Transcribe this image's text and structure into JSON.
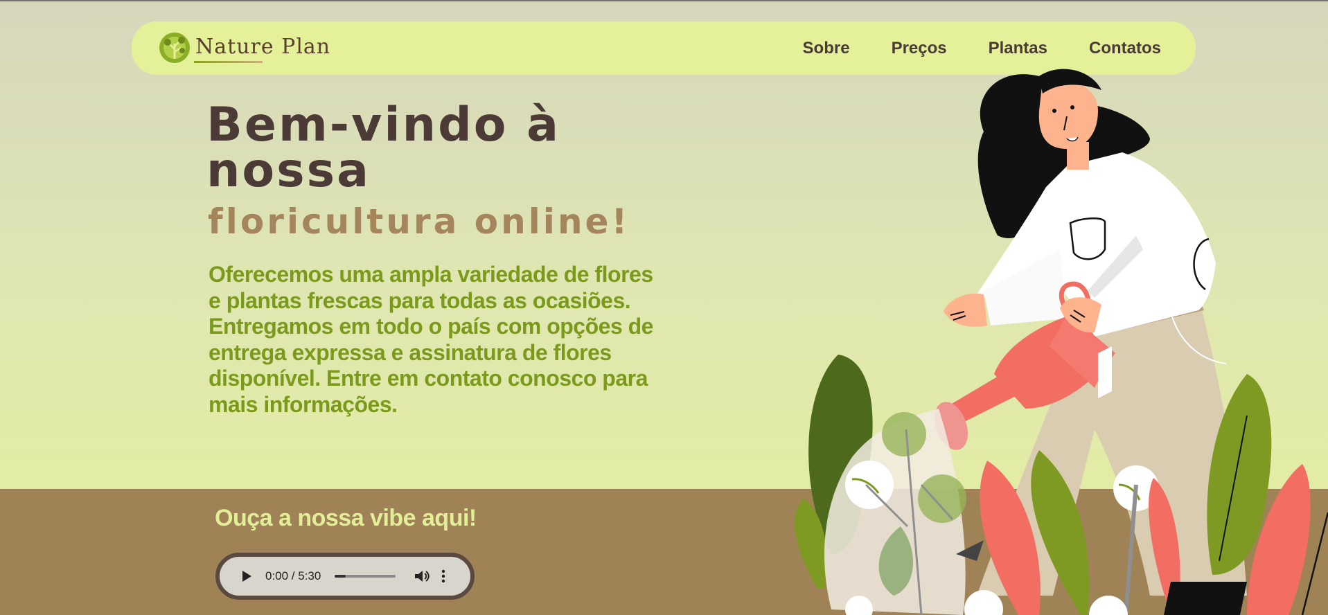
{
  "brand": {
    "name": "Nature Plan"
  },
  "nav": {
    "links": [
      {
        "label": "Sobre"
      },
      {
        "label": "Preços"
      },
      {
        "label": "Plantas"
      },
      {
        "label": "Contatos"
      }
    ]
  },
  "hero": {
    "title": "Bem-vindo à nossa",
    "subtitle": "floricultura online!",
    "description": "Oferecemos uma ampla variedade de flores e plantas frescas para todas as ocasiões. Entregamos em todo o país com opções de entrega expressa e assinatura de flores disponível. Entre em contato conosco para mais informações."
  },
  "audio": {
    "title": "Ouça a nossa vibe aqui!",
    "time": "0:00 / 5:30",
    "progress": 0.0
  },
  "icons": {
    "logo": "leaf-tree-logo-icon",
    "play": "play-icon",
    "volume": "volume-icon",
    "more": "more-vertical-icon"
  },
  "colors": {
    "navbar": "#e4f199",
    "title": "#4c3a36",
    "subtitle": "#a5855c",
    "description": "#7b9a1c",
    "soil": "#a08257",
    "audio_title": "#e3ef98"
  }
}
